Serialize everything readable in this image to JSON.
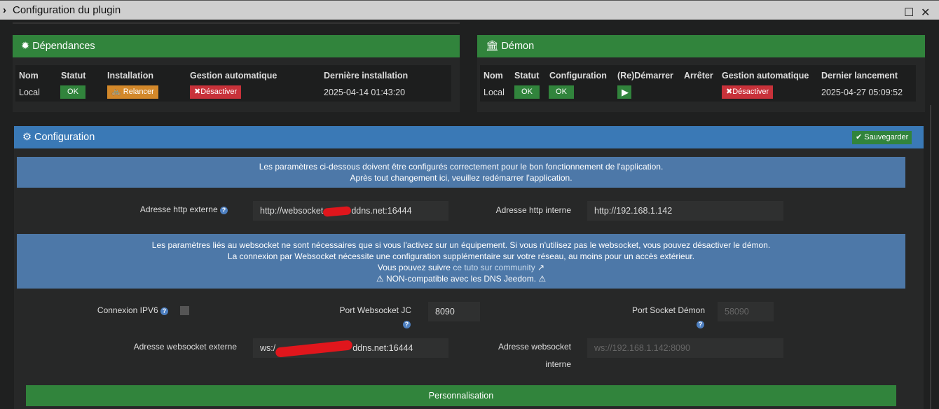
{
  "window": {
    "title": "Configuration du plugin"
  },
  "dependencies": {
    "title": "Dépendances",
    "headers": [
      "Nom",
      "Statut",
      "Installation",
      "Gestion automatique",
      "Dernière installation"
    ],
    "row": {
      "name": "Local",
      "status": "OK",
      "install": "Relancer",
      "auto": "Désactiver",
      "last": "2025-04-14 01:43:20"
    }
  },
  "daemon": {
    "title": "Démon",
    "headers": [
      "Nom",
      "Statut",
      "Configuration",
      "(Re)Démarrer",
      "Arrêter",
      "Gestion automatique",
      "Dernier lancement"
    ],
    "row": {
      "name": "Local",
      "status": "OK",
      "config": "OK",
      "auto": "Désactiver",
      "last": "2025-04-27 05:09:52"
    }
  },
  "config": {
    "title": "Configuration",
    "save": "Sauvegarder",
    "info1": [
      "Les paramètres ci-dessous doivent être configurés correctement pour le bon fonctionnement de l'application.",
      "Après tout changement ici, veuillez redémarrer l'application."
    ],
    "ext_http_label": "Adresse http externe",
    "ext_http_prefix": "http://websocket",
    "ext_http_suffix": "ddns.net:16444",
    "int_http_label": "Adresse http interne",
    "int_http_value": "http://192.168.1.142",
    "info2": [
      "Les paramètres liés au websocket ne sont nécessaires que si vous l'activez sur un équipement. Si vous n'utilisez pas le websocket, vous pouvez désactiver le démon.",
      "La connexion par Websocket nécessite une configuration supplémentaire sur votre réseau, au moins pour un accès extérieur.",
      "Vous pouvez suivre",
      "ce tuto sur community",
      "NON-compatible avec les DNS Jeedom."
    ],
    "ipv6_label": "Connexion IPV6",
    "ws_port_label": "Port Websocket JC",
    "ws_port_value": "8090",
    "daemon_port_label": "Port Socket Démon",
    "daemon_port_placeholder": "58090",
    "ext_ws_label": "Adresse websocket externe",
    "ext_ws_prefix": "ws:/",
    "ext_ws_suffix": "ddns.net:16444",
    "int_ws_label1": "Adresse websocket",
    "int_ws_label2": "interne",
    "int_ws_placeholder": "ws://192.168.1.142:8090",
    "personalisation": "Personnalisation"
  }
}
